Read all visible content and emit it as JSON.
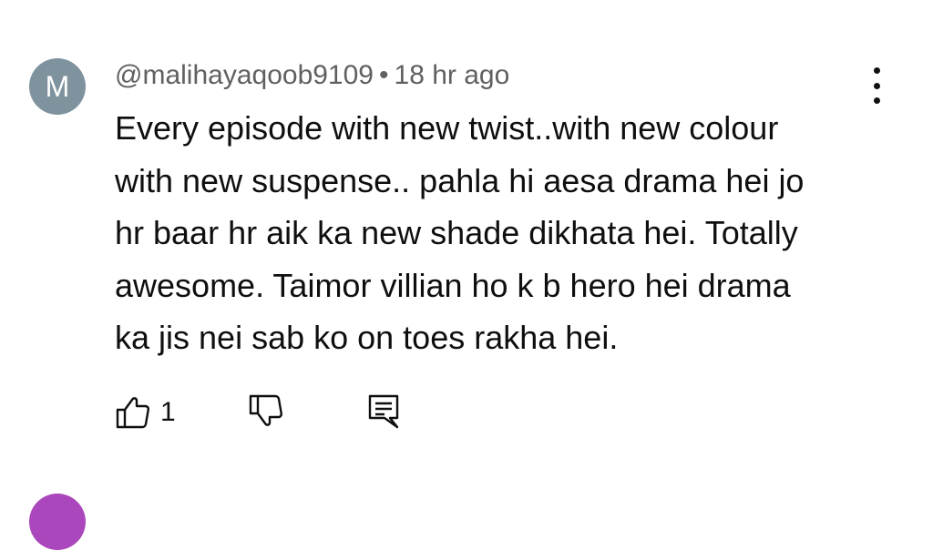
{
  "comment": {
    "avatar_letter": "M",
    "avatar_color": "#7f939f",
    "author": "@malihayaqoob9109",
    "separator": "•",
    "time": "18 hr ago",
    "text_lines": [
      "Every episode with new twist..with new colour",
      "with new suspense.. pahla hi aesa drama hei jo",
      "hr baar hr aik ka new shade dikhata hei. Totally",
      "awesome. Taimor villian ho k b hero hei drama",
      "ka jis nei sab ko on toes rakha hei."
    ],
    "like_count": "1",
    "icons": {
      "menu": "more-vert-icon",
      "like": "thumb-up-icon",
      "dislike": "thumb-down-icon",
      "reply": "comment-icon"
    }
  },
  "next_comment": {
    "avatar_color": "#ab47bc"
  }
}
